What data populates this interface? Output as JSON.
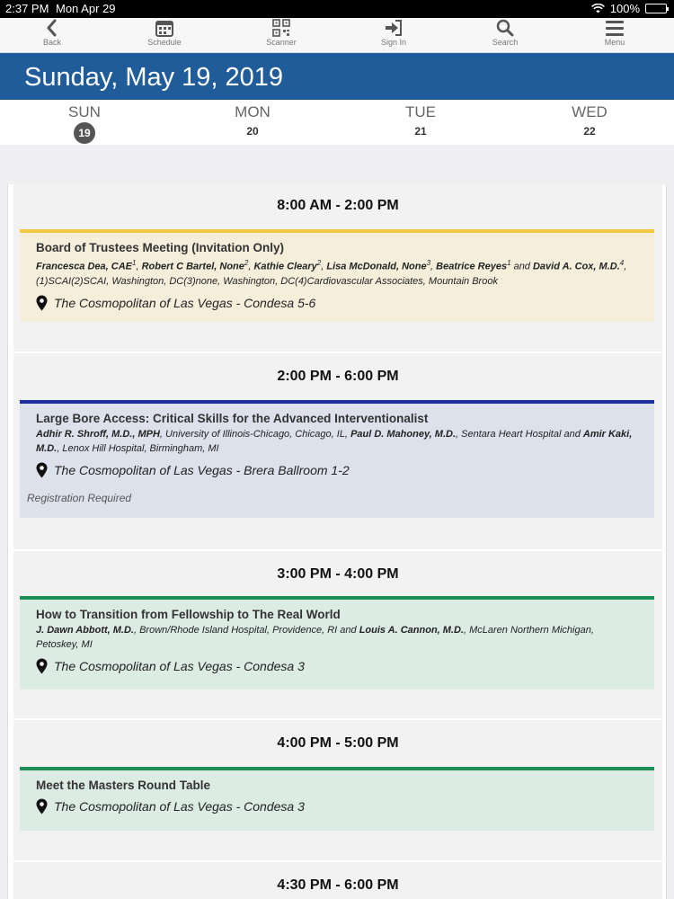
{
  "status": {
    "time": "2:37 PM",
    "date": "Mon Apr 29",
    "battery": "100%"
  },
  "nav": [
    {
      "label": "Back",
      "icon": "chevron-left-icon"
    },
    {
      "label": "Schedule",
      "icon": "calendar-icon"
    },
    {
      "label": "Scanner",
      "icon": "qr-code-icon"
    },
    {
      "label": "Sign In",
      "icon": "sign-in-icon"
    },
    {
      "label": "Search",
      "icon": "search-icon"
    },
    {
      "label": "Menu",
      "icon": "hamburger-menu-icon"
    }
  ],
  "header": {
    "title": "Sunday, May 19, 2019"
  },
  "days": [
    {
      "name": "SUN",
      "num": "19"
    },
    {
      "name": "MON",
      "num": "20"
    },
    {
      "name": "TUE",
      "num": "21"
    },
    {
      "name": "WED",
      "num": "22"
    }
  ],
  "colors": {
    "header_blue": "#1f5c99",
    "yellow": "#f5c842",
    "blue": "#1f2f9e",
    "green": "#1f8f5a"
  },
  "slots": [
    {
      "time": "8:00 AM - 2:00 PM",
      "session": {
        "title": "Board of Trustees Meeting (Invitation Only)",
        "authors": [
          {
            "name": "Francesca Dea, CAE",
            "sup": "1",
            "after": ", "
          },
          {
            "name": "Robert C Bartel, None",
            "sup": "2",
            "after": ", "
          },
          {
            "name": "Kathie Cleary",
            "sup": "2",
            "after": ", "
          },
          {
            "name": "Lisa McDonald, None",
            "sup": "3",
            "after": ", "
          },
          {
            "name": "Beatrice Reyes",
            "sup": "1",
            "after": " and "
          },
          {
            "name": "David A. Cox, M.D.",
            "sup": "4",
            "after": ", (1)SCAI(2)SCAI, Washington, DC(3)none, Washington, DC(4)Cardiovascular Associates, Mountain Brook"
          }
        ],
        "location": "The Cosmopolitan of Las Vegas - Condesa 5-6",
        "note": ""
      }
    },
    {
      "time": "2:00 PM - 6:00 PM",
      "session": {
        "title": "Large Bore Access: Critical Skills for the Advanced Interventionalist",
        "authors": [
          {
            "name": "Adhir R. Shroff, M.D., MPH",
            "sup": "",
            "after": ", University of Illinois-Chicago, Chicago, IL, "
          },
          {
            "name": "Paul D. Mahoney, M.D.",
            "sup": "",
            "after": ", Sentara Heart Hospital and "
          },
          {
            "name": "Amir Kaki, M.D.",
            "sup": "",
            "after": ", Lenox Hill Hospital, Birmingham, MI"
          }
        ],
        "location": "The Cosmopolitan of Las Vegas - Brera Ballroom 1-2",
        "note": "Registration Required"
      }
    },
    {
      "time": "3:00 PM - 4:00 PM",
      "session": {
        "title": "How to Transition from Fellowship to The Real World",
        "authors": [
          {
            "name": "J. Dawn Abbott, M.D.",
            "sup": "",
            "after": ", Brown/Rhode Island Hospital, Providence, RI and "
          },
          {
            "name": "Louis A. Cannon, M.D.",
            "sup": "",
            "after": ", McLaren Northern Michigan, Petoskey, MI"
          }
        ],
        "location": "The Cosmopolitan of Las Vegas - Condesa 3",
        "note": ""
      }
    },
    {
      "time": "4:00 PM - 5:00 PM",
      "session": {
        "title": "Meet the Masters Round Table",
        "authors": [],
        "location": "The Cosmopolitan of Las Vegas - Condesa 3",
        "note": ""
      }
    },
    {
      "time": "4:30 PM - 6:00 PM",
      "session": null
    }
  ]
}
